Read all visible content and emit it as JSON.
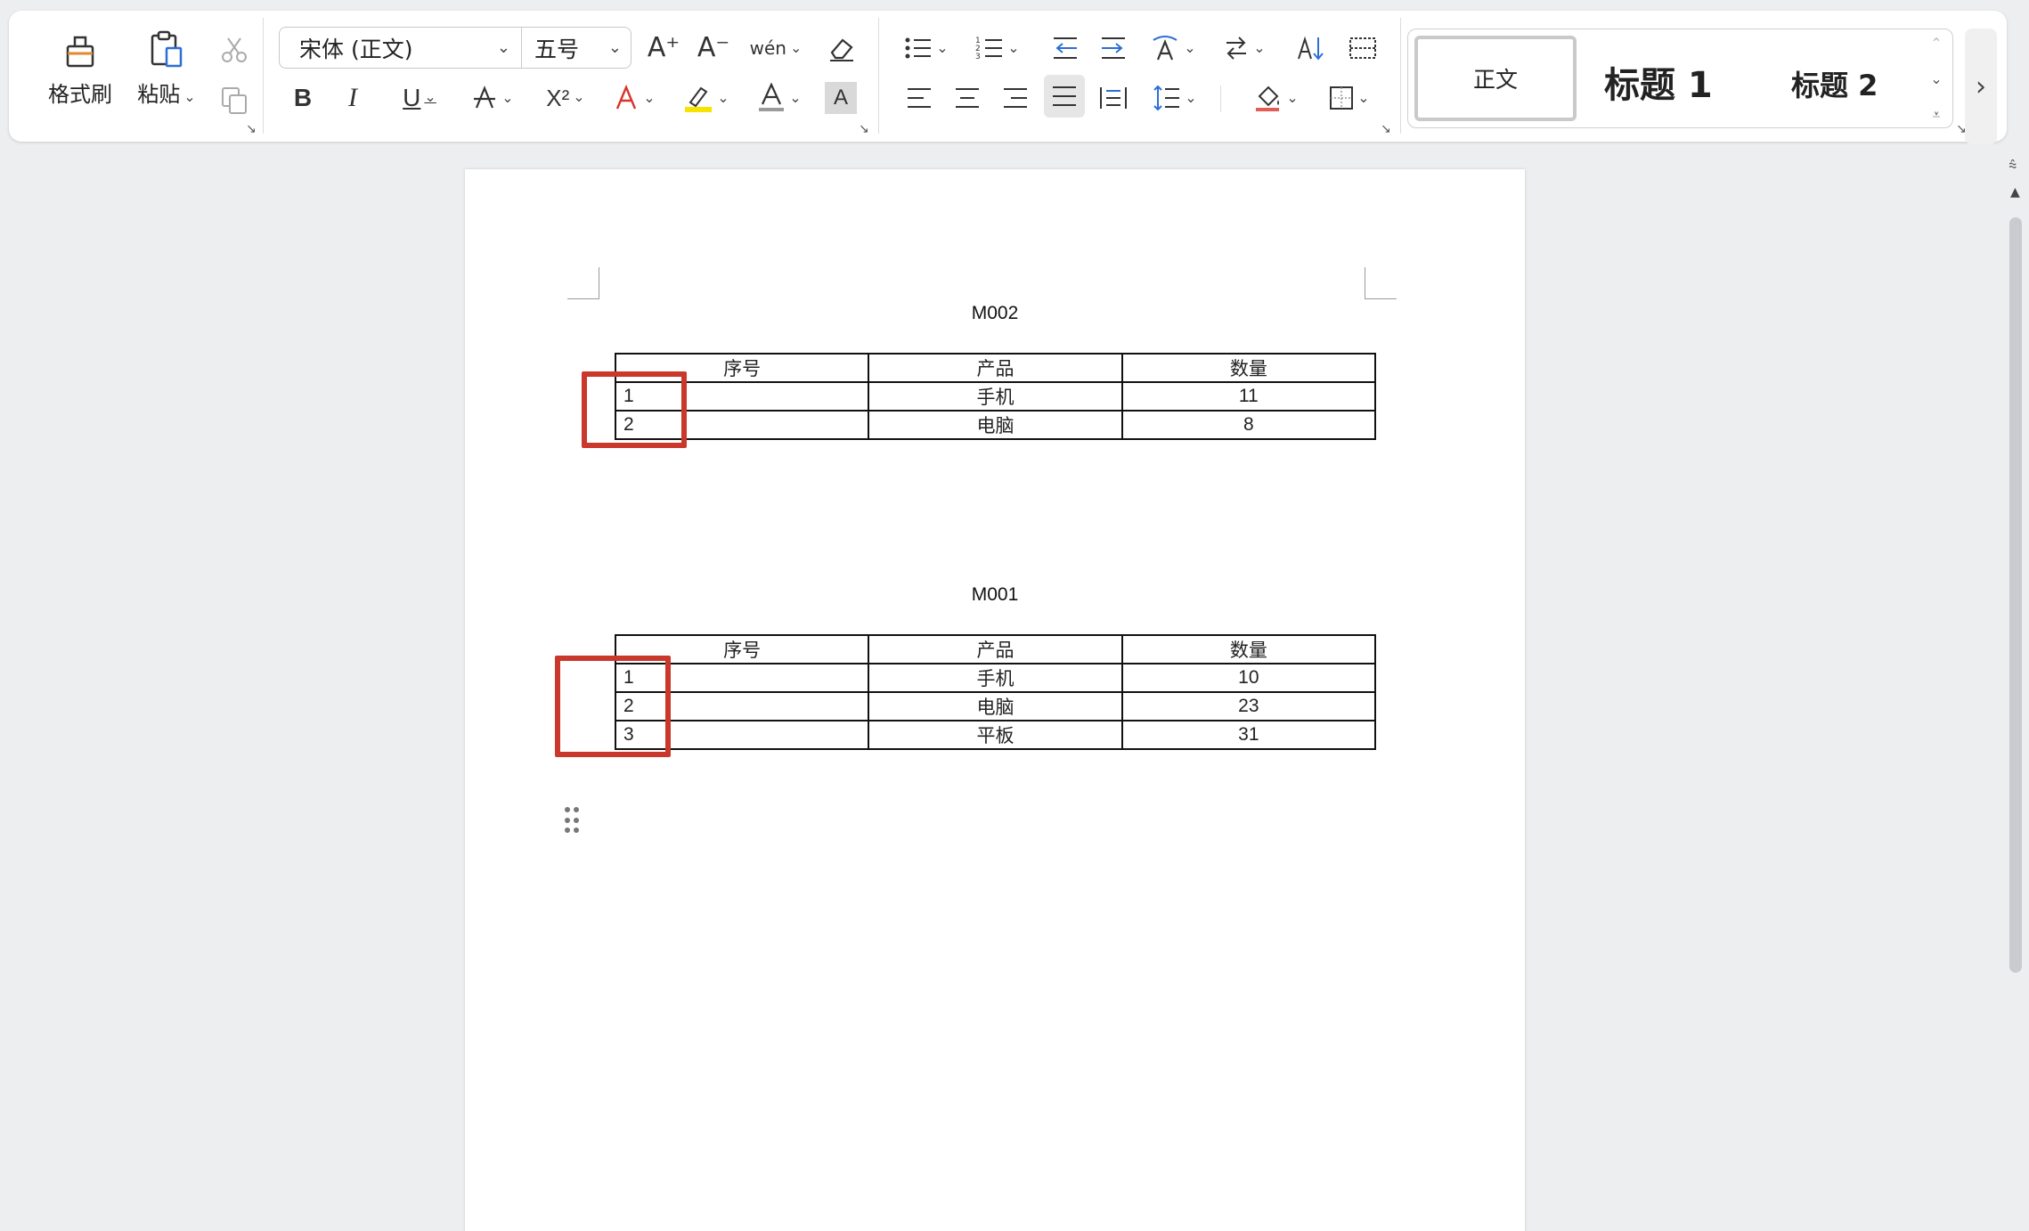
{
  "ribbon": {
    "format_painter_label": "格式刷",
    "paste_label": "粘贴",
    "font_name": "宋体 (正文)",
    "font_size": "五号",
    "bold_label": "B",
    "italic_label": "I",
    "underline_label": "U",
    "superscript_label": "X²",
    "increase_font_label": "A⁺",
    "decrease_font_label": "A⁻",
    "phonetic_label": "wén",
    "styles": {
      "normal": "正文",
      "heading1": "标题 1",
      "heading2": "标题 2"
    }
  },
  "document": {
    "tables": [
      {
        "title": "M002",
        "headers": [
          "序号",
          "产品",
          "数量"
        ],
        "rows": [
          [
            "1",
            "手机",
            "11"
          ],
          [
            "2",
            "电脑",
            "8"
          ]
        ]
      },
      {
        "title": "M001",
        "headers": [
          "序号",
          "产品",
          "数量"
        ],
        "rows": [
          [
            "1",
            "手机",
            "10"
          ],
          [
            "2",
            "电脑",
            "23"
          ],
          [
            "3",
            "平板",
            "31"
          ]
        ]
      }
    ]
  },
  "colors": {
    "highlight": "#c9382b",
    "text_highlight_yellow": "#f5e400",
    "font_color_red": "#d9342b"
  }
}
